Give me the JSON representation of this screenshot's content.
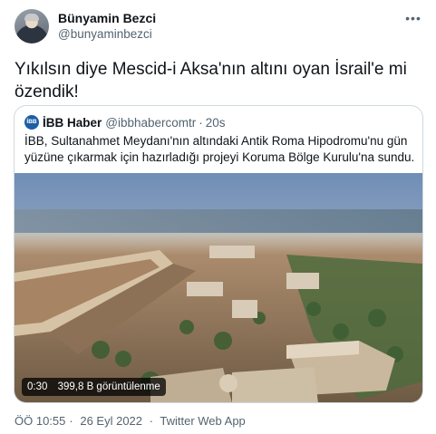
{
  "tweet": {
    "author_name": "Bünyamin Bezci",
    "author_handle": "@bunyaminbezci",
    "more_icon": "more-horizontal-icon",
    "text": "Yıkılsın diye Mescid-i Aksa'nın altını oyan İsrail'e mi özendik!"
  },
  "quote": {
    "logo_text": "İBB",
    "author_name": "İBB Haber",
    "author_handle": "@ibbhabercomtr",
    "separator": "·",
    "time": "20s",
    "text": "İBB, Sultanahmet Meydanı'nın altındaki Antik Roma Hipodromu'nu gün yüzüne çıkarmak için hazırladığı projeyi Koruma Bölge Kurulu'na sundu.",
    "video": {
      "duration": "0:30",
      "views": "399,8 B görüntülenme"
    }
  },
  "meta": {
    "time": "ÖÖ 10:55",
    "dot1": "·",
    "date": "26 Eyl 2022",
    "dot2": "·",
    "source": "Twitter Web App"
  },
  "colors": {
    "text_primary": "#0f1419",
    "text_secondary": "#536471",
    "border": "#cfd9de",
    "ibb_blue": "#1b5fa5"
  }
}
